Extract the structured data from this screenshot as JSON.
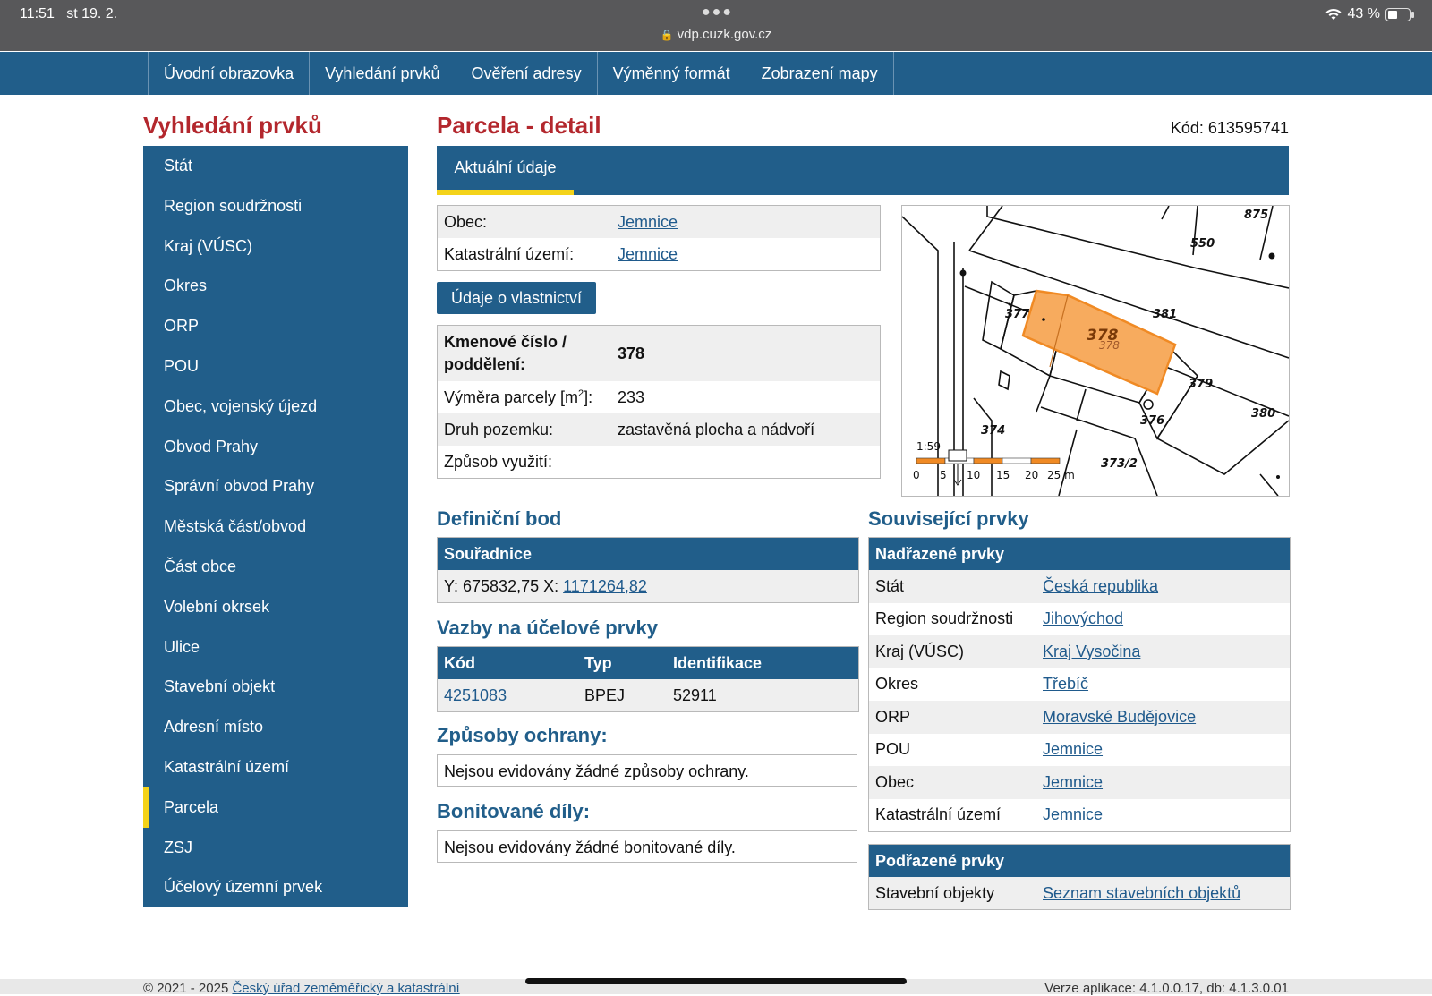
{
  "status": {
    "time": "11:51",
    "date": "st 19. 2.",
    "url": "vdp.cuzk.gov.cz",
    "battery": "43 %"
  },
  "topnav": [
    "Úvodní obrazovka",
    "Vyhledání prvků",
    "Ověření adresy",
    "Výměnný formát",
    "Zobrazení mapy"
  ],
  "sidebar": {
    "title": "Vyhledání prvků",
    "items": [
      "Stát",
      "Region soudržnosti",
      "Kraj (VÚSC)",
      "Okres",
      "ORP",
      "POU",
      "Obec, vojenský újezd",
      "Obvod Prahy",
      "Správní obvod Prahy",
      "Městská část/obvod",
      "Část obce",
      "Volební okrsek",
      "Ulice",
      "Stavební objekt",
      "Adresní místo",
      "Katastrální území",
      "Parcela",
      "ZSJ",
      "Účelový územní prvek"
    ],
    "active": "Parcela"
  },
  "main": {
    "title": "Parcela - detail",
    "code": "Kód: 613595741",
    "tab": "Aktuální údaje",
    "location": {
      "obec_label": "Obec:",
      "obec_value": "Jemnice",
      "ku_label": "Katastrální území:",
      "ku_value": "Jemnice"
    },
    "ownership_button": "Údaje o vlastnictví",
    "parcel": {
      "kmenove_label_1": "Kmenové číslo /",
      "kmenove_label_2": "poddělení:",
      "kmenove_value": "378",
      "vymera_label": "Výměra parcely [m",
      "vymera_sup": "2",
      "vymera_label_end": "]:",
      "vymera_value": "233",
      "druh_label": "Druh pozemku:",
      "druh_value": "zastavěná plocha a nádvoří",
      "zpusob_label": "Způsob využití:",
      "zpusob_value": ""
    },
    "map": {
      "parcel_numbers": [
        "875",
        "550",
        "377",
        "378",
        "381",
        "379",
        "376",
        "380",
        "374",
        "373/2"
      ],
      "highlight_label": "378",
      "highlight_sublabel": "378",
      "highlight_color": "#f7ab5e",
      "scale_ratio": "1:59",
      "scale_ticks": [
        "0",
        "5",
        "10",
        "15",
        "20",
        "25 m"
      ]
    },
    "definicni_bod": {
      "title": "Definiční bod",
      "header": "Souřadnice",
      "coord_prefix": "Y: 675832,75 X:",
      "coord_link": "1171264,82"
    },
    "vazby": {
      "title": "Vazby na účelové prvky",
      "columns": [
        "Kód",
        "Typ",
        "Identifikace"
      ],
      "row": {
        "kod": "4251083",
        "typ": "BPEJ",
        "id": "52911"
      }
    },
    "ochrana": {
      "title": "Způsoby ochrany:",
      "text": "Nejsou evidovány žádné způsoby ochrany."
    },
    "bonitovane": {
      "title": "Bonitované díly:",
      "text": "Nejsou evidovány žádné bonitované díly."
    },
    "souvisejici": {
      "title": "Související prvky",
      "nadrazene_header": "Nadřazené prvky",
      "nadrazene": [
        {
          "label": "Stát",
          "value": "Česká republika"
        },
        {
          "label": "Region soudržnosti",
          "value": "Jihovýchod"
        },
        {
          "label": "Kraj (VÚSC)",
          "value": "Kraj Vysočina"
        },
        {
          "label": "Okres",
          "value": "Třebíč"
        },
        {
          "label": "ORP",
          "value": "Moravské Budějovice"
        },
        {
          "label": "POU",
          "value": "Jemnice"
        },
        {
          "label": "Obec",
          "value": "Jemnice"
        },
        {
          "label": "Katastrální území",
          "value": "Jemnice"
        }
      ],
      "podrazene_header": "Podřazené prvky",
      "podrazene": {
        "label": "Stavební objekty",
        "value": "Seznam stavebních objektů"
      }
    }
  },
  "footer": {
    "left_prefix": "© 2021 - 2025",
    "left_link": "Český úřad zeměměřický a katastrální",
    "right": "Verze aplikace: 4.1.0.0.17, db: 4.1.3.0.01"
  },
  "colors": {
    "nav_blue": "#215e8a",
    "title_red": "#b3272d",
    "active_yellow": "#f4d31a"
  }
}
